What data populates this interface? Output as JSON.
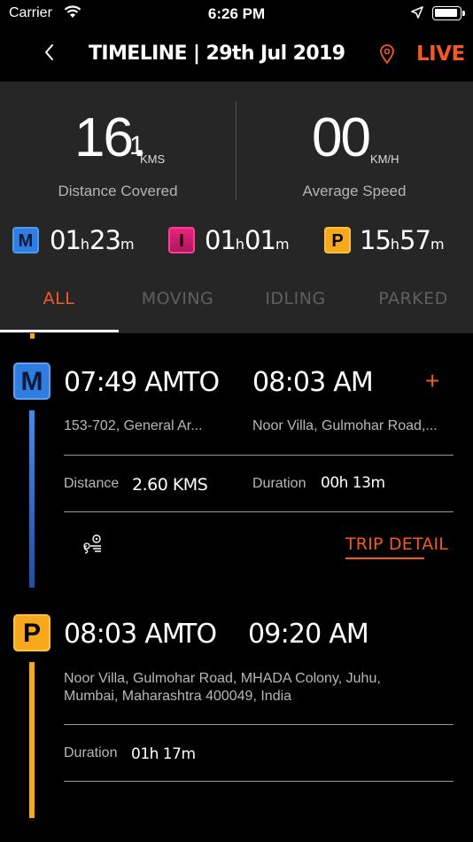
{
  "status_bar": {
    "carrier": "Carrier",
    "time": "6:26 PM"
  },
  "header": {
    "title": "TIMELINE | 29th Jul 2019",
    "live_label": "LIVE"
  },
  "stats": {
    "distance": {
      "int": "16.",
      "dec": "1",
      "unit": "KMS",
      "label": "Distance Covered"
    },
    "speed": {
      "value": "00",
      "unit": "KM/H",
      "label": "Average Speed"
    },
    "moving": {
      "badge": "M",
      "h": "01",
      "h_unit": "h",
      "m": "23",
      "m_unit": "m"
    },
    "idling": {
      "badge": "I",
      "h": "01",
      "h_unit": "h",
      "m": "01",
      "m_unit": "m"
    },
    "parked": {
      "badge": "P",
      "h": "15",
      "h_unit": "h",
      "m": "57",
      "m_unit": "m"
    }
  },
  "tabs": [
    "ALL",
    "MOVING",
    "IDLING",
    "PARKED"
  ],
  "timeline": [
    {
      "badge": "M",
      "from": "07:49 AM",
      "to_label": "TO",
      "to": "08:03 AM",
      "from_address": "153-702, General Ar...",
      "to_address": "Noor Villa, Gulmohar Road,...",
      "distance_label": "Distance",
      "distance_value": "2.60 KMS",
      "duration_label": "Duration",
      "duration_value": "00h 13m",
      "trip_detail_label": "TRIP DETAIL"
    },
    {
      "badge": "P",
      "from": "08:03 AM",
      "to_label": "TO",
      "to": "09:20 AM",
      "address_line1": "Noor Villa, Gulmohar Road, MHADA Colony, Juhu,",
      "address_line2": "Mumbai, Maharashtra 400049, India",
      "duration_label": "Duration",
      "duration_value": "01h 17m"
    }
  ],
  "colors": {
    "accent": "#f25a21",
    "moving": "#2f7de0",
    "idling": "#e8227b",
    "parked": "#f7a81b",
    "panel": "#262626"
  },
  "icons": [
    "wifi-icon",
    "location-arrow-icon",
    "battery-icon",
    "back-chevron-icon",
    "location-pin-icon",
    "plus-icon",
    "route-icon"
  ]
}
